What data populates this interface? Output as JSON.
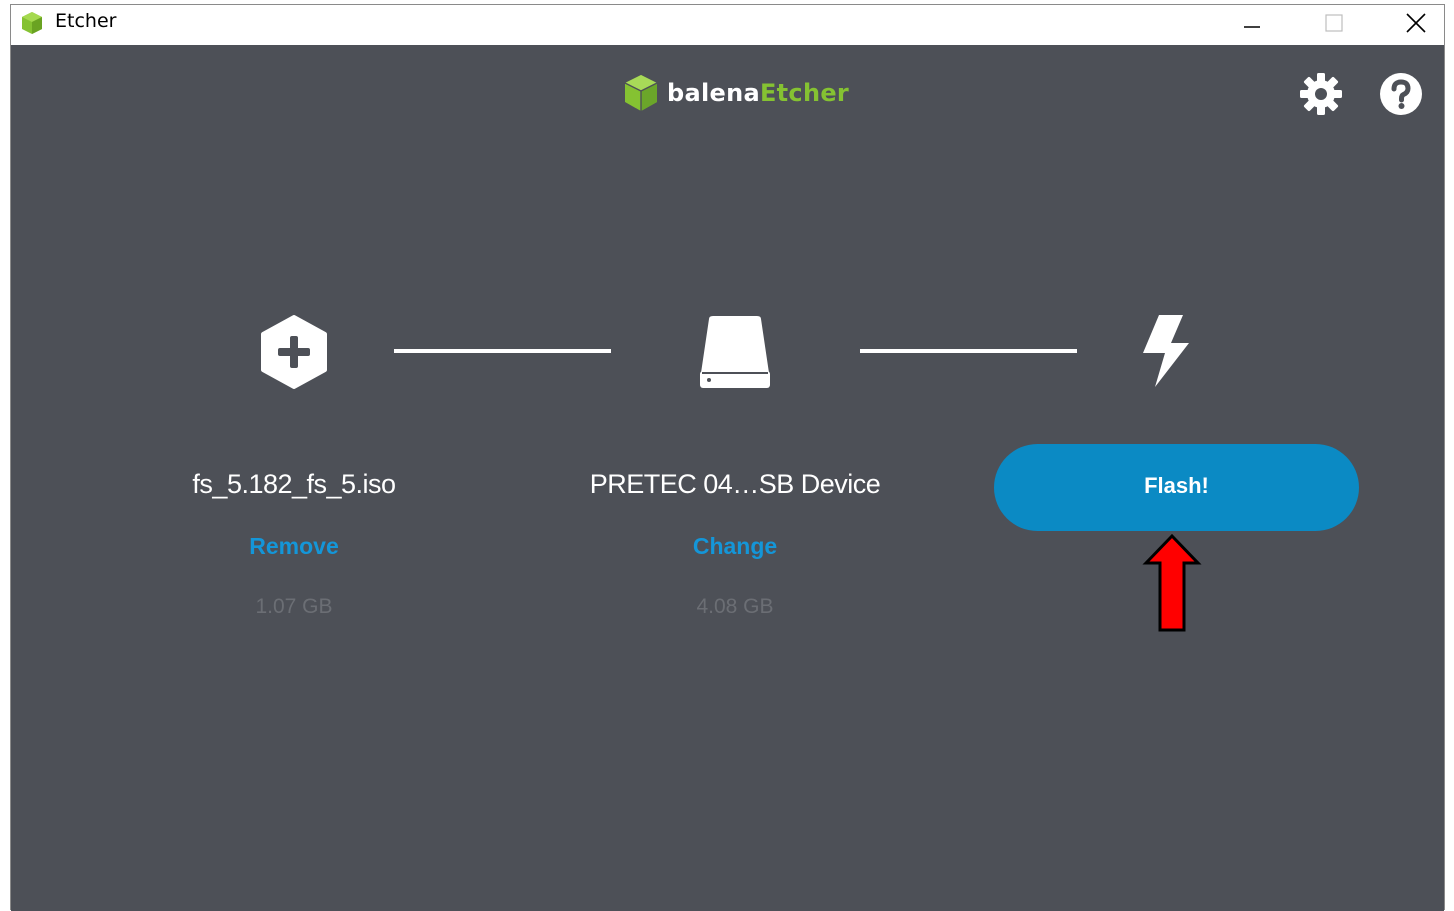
{
  "window": {
    "title": "Etcher"
  },
  "logo": {
    "balena": "balena",
    "etcher": "Etcher"
  },
  "colors": {
    "background": "#4d5057",
    "accent": "#0b8ac4",
    "link": "#1496d8",
    "brand_green": "#85c232",
    "annotation_arrow": "#ff0000"
  },
  "icons": {
    "settings": "gear-icon",
    "help": "help-icon",
    "image_step": "plus-hexagon-icon",
    "drive_step": "drive-icon",
    "flash_step": "lightning-icon"
  },
  "steps": {
    "image": {
      "name": "fs_5.182_fs_5.iso",
      "action": "Remove",
      "size": "1.07 GB"
    },
    "drive": {
      "name": "PRETEC 04…SB Device",
      "action": "Change",
      "size": "4.08 GB"
    },
    "flash": {
      "button_label": "Flash!"
    }
  }
}
